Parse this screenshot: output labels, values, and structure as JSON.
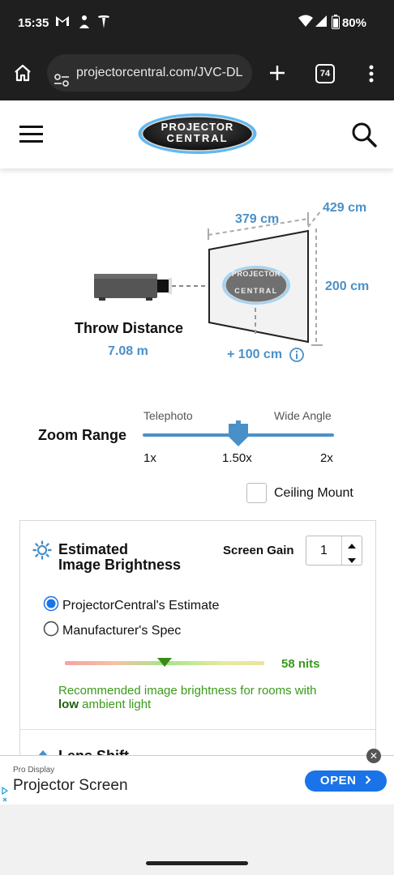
{
  "status_bar": {
    "time": "15:35",
    "battery": "80%"
  },
  "browser": {
    "url": "projectorcentral.com/JVC-DL",
    "tab_count": "74"
  },
  "site": {
    "logo_line1": "PROJECTOR",
    "logo_line2": "CENTRAL"
  },
  "diagram": {
    "width_label": "379 cm",
    "diagonal_label": "429 cm",
    "height_label": "200 cm",
    "offset_label": "+ 100 cm",
    "screen_logo_line1": "PROJECTOR",
    "screen_logo_line2": "CENTRAL",
    "throw_distance_label": "Throw Distance",
    "throw_distance_value": "7.08 m"
  },
  "zoom": {
    "label": "Zoom Range",
    "left_caption": "Telephoto",
    "right_caption": "Wide Angle",
    "min": "1x",
    "current": "1.50x",
    "max": "2x",
    "position_fraction": 0.5
  },
  "ceiling_mount": {
    "label": "Ceiling Mount",
    "checked": false
  },
  "brightness": {
    "title_line1": "Estimated",
    "title_line2": "Image Brightness",
    "screen_gain_label": "Screen Gain",
    "screen_gain_value": "1",
    "option_estimate": "ProjectorCentral's Estimate",
    "option_spec": "Manufacturer's Spec",
    "selected_option": "estimate",
    "nits": "58 nits",
    "meter_fraction": 0.5,
    "recommendation_prefix": "Recommended image brightness for rooms with",
    "recommendation_bold": "low",
    "recommendation_suffix": "ambient light",
    "accent_color": "#3a9a1a",
    "partial_heading": "Lens Shift"
  },
  "ad": {
    "sponsor": "Pro Display",
    "headline": "Projector Screen",
    "cta": "OPEN"
  },
  "colors": {
    "blue": "#4a90c8",
    "green": "#3a9a1a",
    "browser_bg": "#1f1f1f",
    "open_button": "#1a73e8"
  }
}
